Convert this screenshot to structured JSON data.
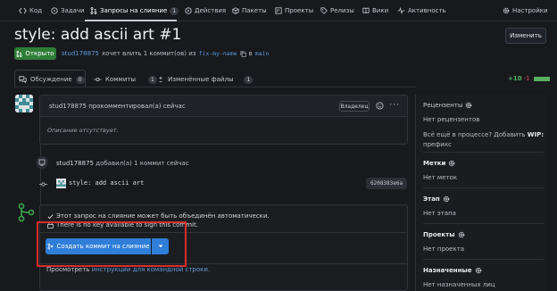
{
  "nav": {
    "items": [
      {
        "label": "Код",
        "icon": "code-icon"
      },
      {
        "label": "Задачи",
        "icon": "issue-icon"
      },
      {
        "label": "Запросы на слияние",
        "icon": "pull-request-icon",
        "count": "1",
        "active": true
      },
      {
        "label": "Действия",
        "icon": "play-icon"
      },
      {
        "label": "Пакеты",
        "icon": "package-icon"
      },
      {
        "label": "Проекты",
        "icon": "project-icon"
      },
      {
        "label": "Релизы",
        "icon": "tag-icon"
      },
      {
        "label": "Вики",
        "icon": "book-icon"
      },
      {
        "label": "Активность",
        "icon": "pulse-icon"
      }
    ],
    "settings": "Настройки"
  },
  "pr": {
    "title": "style: add ascii art #1",
    "edit_label": "Изменить",
    "status": "Открыто",
    "author": "stud178875",
    "subtitle_text": "хочет влить 1 коммит(ов) из",
    "source_branch": "fix-my-name",
    "into_text": "в",
    "target_branch": "main"
  },
  "tabs": [
    {
      "label": "Обсуждение",
      "count": "0",
      "icon": "discussion-icon"
    },
    {
      "label": "Коммиты",
      "count": "1",
      "icon": "commit-icon"
    },
    {
      "label": "Изменённые файлы",
      "count": "1",
      "icon": "diff-icon"
    }
  ],
  "diffstat": {
    "added": "+10",
    "removed": "-1"
  },
  "comment": {
    "author": "stud178875",
    "action": "прокомментировал(а) сейчас",
    "badge": "Владелец",
    "body": "Описание отсутствует."
  },
  "event": {
    "author": "stud178875",
    "text": "добавил(а) 1 коммит сейчас",
    "commit_message": "style: add ascii art",
    "sha": "6208383e6a"
  },
  "merge": {
    "status": "Этот запрос на слияние может быть объединён автоматически.",
    "sign_note": "There is no key available to sign this commit.",
    "button_label": "Создать коммит на слияние",
    "cli_prefix": "Просмотреть",
    "cli_link": "инструкции для командной строки."
  },
  "sidebar": {
    "reviewers": {
      "title": "Рецензенты",
      "value": "Нет рецензентов"
    },
    "wip": {
      "text": "Всё ещё в процессе? Добавить",
      "bold": "WIP:",
      "suffix": "префикс"
    },
    "labels": {
      "title": "Метки",
      "value": "Нет меток"
    },
    "milestone": {
      "title": "Этап",
      "value": "Нет этапа"
    },
    "projects": {
      "title": "Проекты",
      "value": "Нет проекта"
    },
    "assignees": {
      "title": "Назначенные",
      "value": "Нет назначенных лиц"
    }
  },
  "colors": {
    "accent": "#2f7ed8",
    "open": "#2f7d37",
    "highlight": "#d92b2b",
    "added": "#57b05f",
    "removed": "#d9534f"
  }
}
